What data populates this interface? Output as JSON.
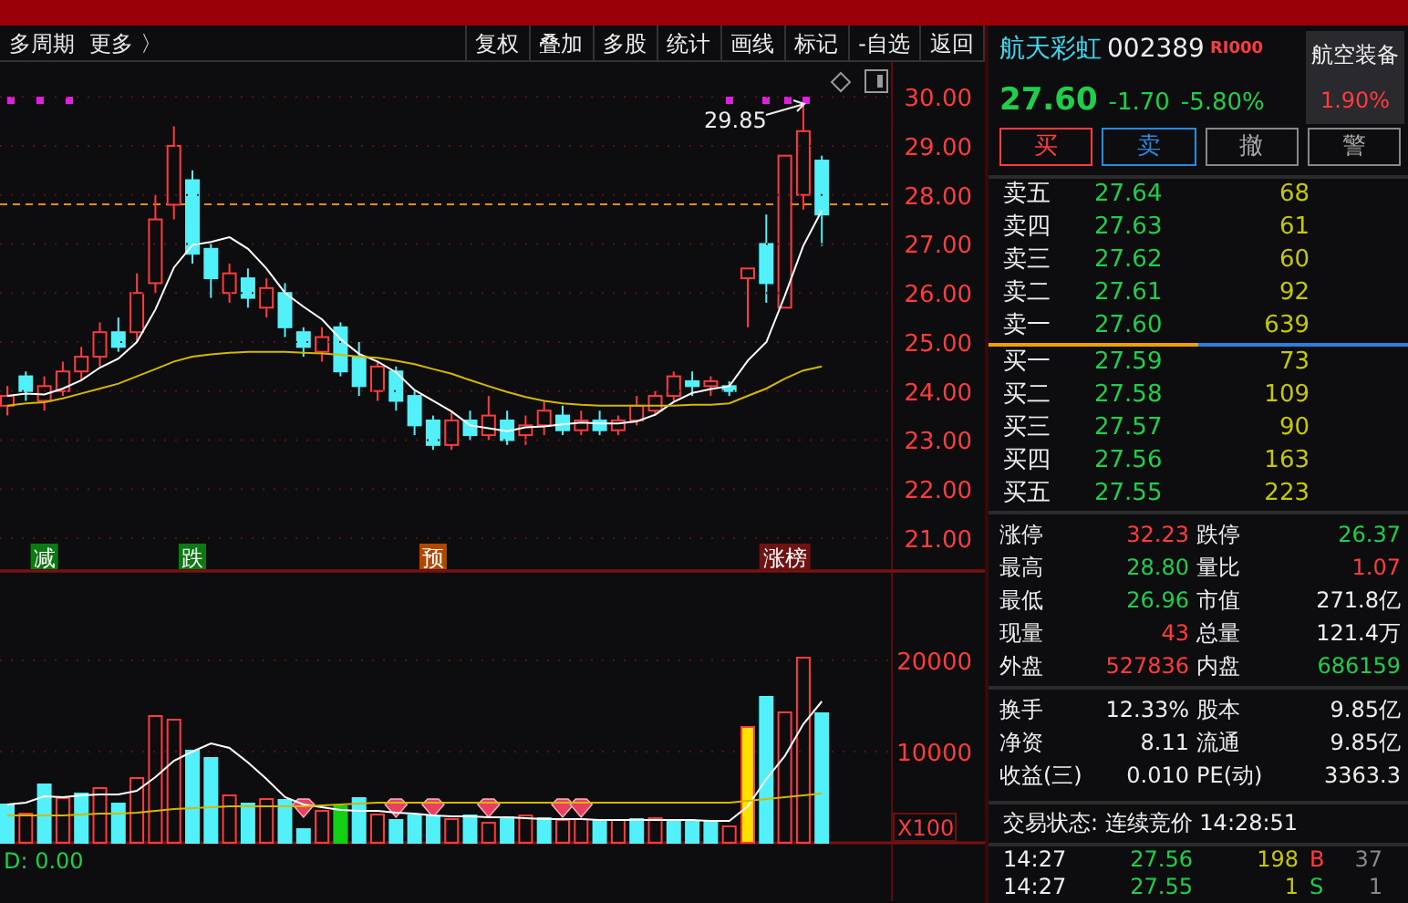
{
  "toolbar": {
    "left": [
      "多周期",
      "更多 〉"
    ],
    "right": [
      "复权",
      "叠加",
      "多股",
      "统计",
      "画线",
      "标记",
      "-自选",
      "返回"
    ]
  },
  "price_chart": {
    "chart_data": {
      "type": "candlestick",
      "grid": true,
      "ylim": [
        20.33,
        30.71
      ],
      "ohlc": [
        [
          23.7,
          24.1,
          23.5,
          23.9
        ],
        [
          24.3,
          24.4,
          23.8,
          24.0
        ],
        [
          23.8,
          24.3,
          23.6,
          24.1
        ],
        [
          24.0,
          24.6,
          23.9,
          24.4
        ],
        [
          24.4,
          24.9,
          24.2,
          24.7
        ],
        [
          24.7,
          25.4,
          24.5,
          25.2
        ],
        [
          25.2,
          25.5,
          24.8,
          24.9
        ],
        [
          25.2,
          26.4,
          25.0,
          26.0
        ],
        [
          26.2,
          28.0,
          26.0,
          27.5
        ],
        [
          27.8,
          29.4,
          27.5,
          29.0
        ],
        [
          28.3,
          28.5,
          26.6,
          26.8
        ],
        [
          26.9,
          27.0,
          25.9,
          26.3
        ],
        [
          26.0,
          26.6,
          25.8,
          26.4
        ],
        [
          26.3,
          26.5,
          25.7,
          25.9
        ],
        [
          25.7,
          26.3,
          25.5,
          26.1
        ],
        [
          26.0,
          26.2,
          25.1,
          25.3
        ],
        [
          25.2,
          25.3,
          24.7,
          24.9
        ],
        [
          24.8,
          25.3,
          24.6,
          25.1
        ],
        [
          25.3,
          25.4,
          24.3,
          24.4
        ],
        [
          24.7,
          25.0,
          23.9,
          24.1
        ],
        [
          24.0,
          24.6,
          23.8,
          24.5
        ],
        [
          24.4,
          24.5,
          23.6,
          23.8
        ],
        [
          23.9,
          24.0,
          23.1,
          23.3
        ],
        [
          23.4,
          23.5,
          22.8,
          22.9
        ],
        [
          22.9,
          23.6,
          22.8,
          23.4
        ],
        [
          23.4,
          23.6,
          23.0,
          23.1
        ],
        [
          23.1,
          23.9,
          23.0,
          23.5
        ],
        [
          23.4,
          23.6,
          22.9,
          23.0
        ],
        [
          23.1,
          23.5,
          22.9,
          23.3
        ],
        [
          23.3,
          23.8,
          23.1,
          23.6
        ],
        [
          23.5,
          23.7,
          23.1,
          23.2
        ],
        [
          23.2,
          23.6,
          23.1,
          23.4
        ],
        [
          23.4,
          23.6,
          23.1,
          23.2
        ],
        [
          23.2,
          23.5,
          23.1,
          23.4
        ],
        [
          23.4,
          23.9,
          23.3,
          23.7
        ],
        [
          23.6,
          24.0,
          23.5,
          23.9
        ],
        [
          23.9,
          24.4,
          23.8,
          24.3
        ],
        [
          24.2,
          24.4,
          23.9,
          24.1
        ],
        [
          24.1,
          24.3,
          23.9,
          24.2
        ],
        [
          24.1,
          24.2,
          23.9,
          24.0
        ],
        [
          26.3,
          26.5,
          25.3,
          26.5
        ],
        [
          27.0,
          27.6,
          25.8,
          26.2
        ],
        [
          25.7,
          28.8,
          25.7,
          28.8
        ],
        [
          28.0,
          29.85,
          27.7,
          29.3
        ],
        [
          28.7,
          28.8,
          26.96,
          27.6
        ]
      ],
      "yticks": [
        {
          "value": 30,
          "label": "30.00"
        },
        {
          "value": 29,
          "label": "29.00"
        },
        {
          "value": 28,
          "label": "28.00"
        },
        {
          "value": 27,
          "label": "27.00"
        },
        {
          "value": 26,
          "label": "26.00"
        },
        {
          "value": 25,
          "label": "25.00"
        },
        {
          "value": 24,
          "label": "24.00"
        },
        {
          "value": 23,
          "label": "23.00"
        },
        {
          "value": 22,
          "label": "22.00"
        },
        {
          "value": 21,
          "label": "21.00"
        }
      ],
      "series": [
        {
          "type": "line",
          "color": "#ffffff",
          "values": [
            23.9,
            23.95,
            23.93,
            24.05,
            24.22,
            24.48,
            24.66,
            25.0,
            25.66,
            26.52,
            26.98,
            27.04,
            27.14,
            26.9,
            26.5,
            26.0,
            25.72,
            25.46,
            25.06,
            24.76,
            24.6,
            24.38,
            24.02,
            23.8,
            23.58,
            23.3,
            23.24,
            23.18,
            23.26,
            23.28,
            23.32,
            23.36,
            23.34,
            23.34,
            23.38,
            23.52,
            23.78,
            23.96,
            24.04,
            24.1,
            24.62,
            25.0,
            25.94,
            26.96,
            27.68
          ]
        },
        {
          "type": "line",
          "color": "#d4b800",
          "values": [
            23.7,
            23.75,
            23.77,
            23.85,
            23.95,
            24.05,
            24.15,
            24.3,
            24.45,
            24.6,
            24.7,
            24.75,
            24.78,
            24.8,
            24.8,
            24.8,
            24.78,
            24.77,
            24.74,
            24.7,
            24.68,
            24.62,
            24.55,
            24.45,
            24.35,
            24.22,
            24.1,
            23.98,
            23.88,
            23.8,
            23.75,
            23.72,
            23.7,
            23.7,
            23.7,
            23.7,
            23.7,
            23.72,
            23.72,
            23.75,
            23.9,
            24.05,
            24.25,
            24.42,
            24.5
          ]
        }
      ]
    },
    "peak_label": "29.85"
  },
  "signals": [
    {
      "text": "减",
      "color": "#0b7a12"
    },
    {
      "text": "跌",
      "color": "#0b7a12"
    },
    {
      "text": "预",
      "color": "#b34700"
    },
    {
      "text": "涨榜",
      "color": "#6e1212"
    }
  ],
  "volume_chart": {
    "chart_data": {
      "type": "bar",
      "grid": true,
      "stacked": true,
      "ylim": [
        0,
        29800
      ],
      "yticks": [
        10000,
        20000
      ],
      "series": [
        {
          "color": "#ff3b3b",
          "values": [
            null,
            3200,
            null,
            4900,
            null,
            6000,
            null,
            7100,
            13900,
            13500,
            null,
            null,
            5200,
            null,
            4800,
            null,
            null,
            3500,
            null,
            null,
            3100,
            null,
            null,
            null,
            2600,
            null,
            2200,
            null,
            3000,
            null,
            2500,
            2600,
            null,
            2500,
            null,
            2700,
            null,
            null,
            null,
            1800,
            null,
            null,
            14300,
            20300,
            null
          ]
        },
        {
          "color": "#52f0f8",
          "values": [
            4200,
            null,
            6400,
            null,
            5400,
            null,
            4300,
            null,
            null,
            null,
            10100,
            9300,
            null,
            4300,
            null,
            4700,
            1500,
            null,
            null,
            4900,
            null,
            2500,
            3000,
            2900,
            null,
            3000,
            null,
            2800,
            null,
            2700,
            null,
            null,
            2400,
            null,
            2600,
            null,
            2500,
            2400,
            2300,
            null,
            null,
            16000,
            null,
            null,
            14200
          ]
        },
        {
          "color": "#14d014",
          "values": [
            null,
            null,
            null,
            null,
            null,
            null,
            null,
            null,
            null,
            null,
            null,
            null,
            null,
            null,
            null,
            null,
            null,
            null,
            4000,
            null,
            null,
            null,
            null,
            null,
            null,
            null,
            null,
            null,
            null,
            null,
            null,
            null,
            null,
            null,
            null,
            null,
            null,
            null,
            null,
            null,
            null,
            null,
            null,
            null,
            null
          ]
        },
        {
          "color": "#ffe000",
          "values": [
            null,
            null,
            null,
            null,
            null,
            null,
            null,
            null,
            null,
            null,
            null,
            null,
            null,
            null,
            null,
            null,
            null,
            null,
            null,
            null,
            null,
            null,
            null,
            null,
            null,
            null,
            null,
            null,
            null,
            null,
            null,
            null,
            null,
            null,
            null,
            null,
            null,
            null,
            null,
            null,
            12700,
            null,
            null,
            null,
            null
          ]
        },
        {
          "type": "line",
          "color": "#ffffff",
          "values": [
            4200,
            4400,
            5100,
            5000,
            5200,
            5300,
            5300,
            5700,
            7200,
            9000,
            10000,
            10900,
            10400,
            8800,
            7000,
            5000,
            4200,
            3900,
            3600,
            3500,
            3500,
            3300,
            3200,
            3000,
            2900,
            2900,
            2800,
            2800,
            2700,
            2600,
            2600,
            2600,
            2500,
            2500,
            2500,
            2500,
            2500,
            2500,
            2400,
            2400,
            4000,
            7000,
            9500,
            13000,
            15500
          ]
        },
        {
          "type": "line",
          "color": "#d4b800",
          "values": [
            3000,
            3000,
            3000,
            3000,
            3100,
            3200,
            3200,
            3300,
            3500,
            3700,
            3800,
            3900,
            4000,
            4000,
            4000,
            4000,
            4000,
            4100,
            4200,
            4300,
            4400,
            4400,
            4400,
            4400,
            4400,
            4400,
            4400,
            4400,
            4400,
            4400,
            4400,
            4400,
            4400,
            4400,
            4400,
            4400,
            4400,
            4400,
            4400,
            4400,
            4600,
            4800,
            5000,
            5200,
            5400
          ]
        }
      ]
    },
    "unit": "X100"
  },
  "indicator": "D: 0.00",
  "quote": {
    "name": "航天彩虹",
    "code": "002389",
    "badge": "RI000",
    "price": "27.60",
    "change": "-1.70",
    "change_pct": "-5.80%",
    "sector": "航空装备",
    "sector_change": "1.90%"
  },
  "actions": [
    {
      "label": "买",
      "kind": "buy"
    },
    {
      "label": "卖",
      "kind": "sell"
    },
    {
      "label": "撤",
      "kind": "cancel"
    },
    {
      "label": "警",
      "kind": "alert"
    }
  ],
  "asks": [
    {
      "label": "卖五",
      "price": "27.64",
      "volume": "68"
    },
    {
      "label": "卖四",
      "price": "27.63",
      "volume": "61"
    },
    {
      "label": "卖三",
      "price": "27.62",
      "volume": "60"
    },
    {
      "label": "卖二",
      "price": "27.61",
      "volume": "92"
    },
    {
      "label": "卖一",
      "price": "27.60",
      "volume": "639"
    }
  ],
  "bids": [
    {
      "label": "买一",
      "price": "27.59",
      "volume": "73"
    },
    {
      "label": "买二",
      "price": "27.58",
      "volume": "109"
    },
    {
      "label": "买三",
      "price": "27.57",
      "volume": "90"
    },
    {
      "label": "买四",
      "price": "27.56",
      "volume": "163"
    },
    {
      "label": "买五",
      "price": "27.55",
      "volume": "223"
    }
  ],
  "stats": [
    {
      "label": "涨停",
      "value": "32.23",
      "color": "#ff3b3b"
    },
    {
      "label": "跌停",
      "value": "26.37",
      "color": "#1fcf4a"
    },
    {
      "label": "最高",
      "value": "28.80",
      "color": "#1fcf4a"
    },
    {
      "label": "量比",
      "value": "1.07",
      "color": "#ff3b3b"
    },
    {
      "label": "最低",
      "value": "26.96",
      "color": "#1fcf4a"
    },
    {
      "label": "市值",
      "value": "271.8亿",
      "color": "#eeeeee"
    },
    {
      "label": "现量",
      "value": "43",
      "color": "#ff3b3b"
    },
    {
      "label": "总量",
      "value": "121.4万",
      "color": "#eeeeee"
    },
    {
      "label": "外盘",
      "value": "527836",
      "color": "#ff3b3b"
    },
    {
      "label": "内盘",
      "value": "686159",
      "color": "#1fcf4a"
    }
  ],
  "fundamentals": [
    {
      "label": "换手",
      "value": "12.33%"
    },
    {
      "label": "股本",
      "value": "9.85亿"
    },
    {
      "label": "净资",
      "value": "8.11"
    },
    {
      "label": "流通",
      "value": "9.85亿"
    },
    {
      "label": "收益(三)",
      "value": "0.010"
    },
    {
      "label": "PE(动)",
      "value": "3363.3"
    }
  ],
  "trade_status": "交易状态: 连续竞价 14:28:51",
  "ticks": [
    {
      "time": "14:27",
      "price": "27.56",
      "volume": "198",
      "side": "B",
      "count": "37"
    },
    {
      "time": "14:27",
      "price": "27.55",
      "volume": "1",
      "side": "S",
      "count": "1"
    }
  ]
}
